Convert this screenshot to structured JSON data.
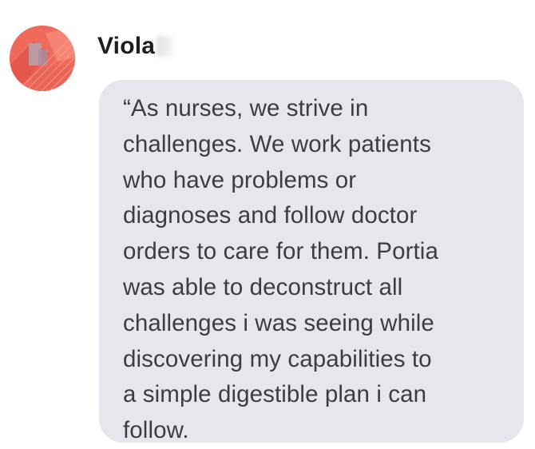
{
  "comment": {
    "author_name": "Viola",
    "message": "“As nurses, we strive in\nchallenges. We work patients\nwho have problems or\ndiagnoses and follow doctor\norders to care for them. Portia\nwas able to deconstruct all\nchallenges i was seeing while\ndiscovering my capabilities to\na simple digestible plan i can\nfollow."
  },
  "colors": {
    "bubble_background": "#e5e7ec",
    "message_text": "#3a3d44",
    "name_text": "#1c1e21",
    "avatar_primary": "#ef6a5b"
  }
}
